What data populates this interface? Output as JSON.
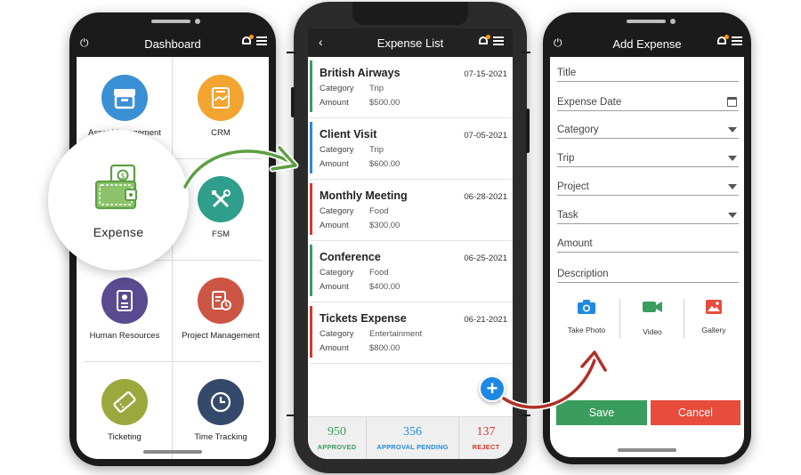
{
  "dashboard": {
    "title": "Dashboard",
    "tiles": [
      {
        "label": "Asset Management",
        "icon": "archive-box-icon",
        "color": "#3b8fd4"
      },
      {
        "label": "CRM",
        "icon": "handshake-icon",
        "color": "#f2a531"
      },
      {
        "label": "Expense",
        "icon": "wallet-money-icon",
        "color": "#5d9f43"
      },
      {
        "label": "FSM",
        "icon": "tools-icon",
        "color": "#2f9e8c"
      },
      {
        "label": "Human Resources",
        "icon": "profile-checklist-icon",
        "color": "#5a4a8f"
      },
      {
        "label": "Project Management",
        "icon": "clipboard-clock-icon",
        "color": "#cc5543"
      },
      {
        "label": "Ticketing",
        "icon": "ticket-icon",
        "color": "#9aa83d"
      },
      {
        "label": "Time Tracking",
        "icon": "clock-icon",
        "color": "#354a6b"
      }
    ]
  },
  "expense_list": {
    "title": "Expense List",
    "category_label": "Category",
    "amount_label": "Amount",
    "items": [
      {
        "title": "British Airways",
        "date": "07-15-2021",
        "category": "Trip",
        "amount": "$500.00",
        "status_color": "#3a9d5d"
      },
      {
        "title": "Client Visit",
        "date": "07-05-2021",
        "category": "Trip",
        "amount": "$600.00",
        "status_color": "#2b8ad6"
      },
      {
        "title": "Monthly Meeting",
        "date": "06-28-2021",
        "category": "Food",
        "amount": "$300.00",
        "status_color": "#d33a2c"
      },
      {
        "title": "Conference",
        "date": "06-25-2021",
        "category": "Food",
        "amount": "$400.00",
        "status_color": "#3a9d5d"
      },
      {
        "title": "Tickets Expense",
        "date": "06-21-2021",
        "category": "Entertainment",
        "amount": "$800.00",
        "status_color": "#d33a2c"
      }
    ],
    "fab": "+",
    "stats": [
      {
        "value": "950",
        "caption": "APPROVED",
        "color": "#3a9d5d"
      },
      {
        "value": "356",
        "caption": "APPROVAL PENDING",
        "color": "#2b8ad6"
      },
      {
        "value": "137",
        "caption": "REJECT",
        "color": "#d33a2c"
      }
    ]
  },
  "add_expense": {
    "title": "Add Expense",
    "fields": [
      {
        "label": "Title",
        "kind": "text"
      },
      {
        "label": "Expense Date",
        "kind": "date"
      },
      {
        "label": "Category",
        "kind": "select"
      },
      {
        "label": "Trip",
        "kind": "select"
      },
      {
        "label": "Project",
        "kind": "select"
      },
      {
        "label": "Task",
        "kind": "select"
      },
      {
        "label": "Amount",
        "kind": "text"
      },
      {
        "label": "Description",
        "kind": "text"
      }
    ],
    "media": [
      {
        "label": "Take Photo",
        "icon": "camera-icon"
      },
      {
        "label": "Video",
        "icon": "video-camera-icon"
      },
      {
        "label": "Gallery",
        "icon": "image-icon"
      }
    ],
    "save_label": "Save",
    "cancel_label": "Cancel",
    "save_color": "#3a9d5d",
    "cancel_color": "#e74c3c"
  }
}
